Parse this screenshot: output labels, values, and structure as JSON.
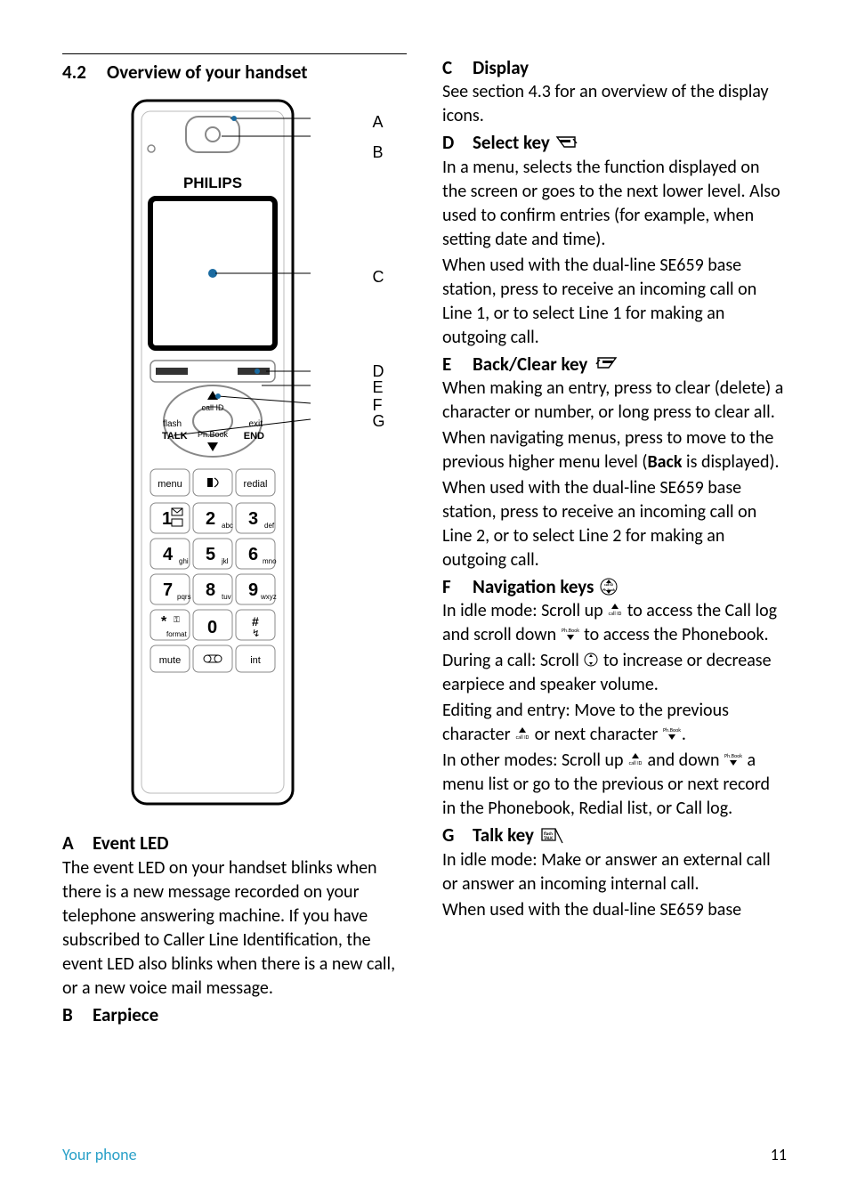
{
  "section": {
    "number": "4.2",
    "title": "Overview of your handset"
  },
  "callouts": [
    "A",
    "B",
    "C",
    "D",
    "E",
    "F",
    "G"
  ],
  "handset": {
    "brand": "PHILIPS",
    "keys": {
      "flash": "flash",
      "talk": "TALK",
      "exit": "exit",
      "end": "END",
      "call_id": "call ID",
      "phbook": "Ph.Book",
      "menu": "menu",
      "redial": "redial",
      "mute": "mute",
      "int": "int"
    },
    "digits": {
      "1_sub": "",
      "2": "2",
      "2_sub": "abc",
      "3": "3",
      "3_sub": "def",
      "4": "4",
      "4_sub": "ghi",
      "5": "5",
      "5_sub": "jkl",
      "6": "6",
      "6_sub": "mno",
      "7": "7",
      "7_sub": "pqrs",
      "8": "8",
      "8_sub": "tuv",
      "9": "9",
      "9_sub": "wxyz",
      "star": "*",
      "star_sub": "format",
      "0": "0",
      "hash": "#"
    }
  },
  "left": {
    "A": {
      "title": "Event LED",
      "text": "The event LED on your handset blinks when there is a new message recorded on your telephone answering machine. If you have subscribed to Caller Line Identification, the event LED also blinks when there is a new call, or a new voice mail message."
    },
    "B": {
      "title": "Earpiece"
    }
  },
  "right": {
    "C": {
      "title": "Display",
      "text": "See section 4.3 for an overview of the display icons."
    },
    "D": {
      "title": "Select key",
      "p1": "In a menu, selects the function displayed on the screen or goes to the next lower level. Also used to confirm entries (for example, when setting date and time).",
      "p2": "When used with the dual-line SE659 base station, press to receive an incoming call on Line 1, or to select Line 1 for making an outgoing call."
    },
    "E": {
      "title": "Back/Clear key",
      "p1": "When making an entry, press to clear (delete) a character or number, or long press to clear all.",
      "p2a": "When navigating menus, press to move to the previous higher menu level (",
      "p2_bold": "Back",
      "p2b": " is displayed).",
      "p3": "When used with the dual-line SE659 base station, press to receive an incoming call on Line 2, or to select Line 2 for making an outgoing call."
    },
    "F": {
      "title": "Navigation keys",
      "p1a": "In idle mode: Scroll up ",
      "p1b": " to access the Call log and scroll down ",
      "p1c": " to access the Phonebook.",
      "p2a": "During a call: Scroll ",
      "p2b": " to increase or decrease earpiece and speaker volume.",
      "p3a": "Editing and entry: Move to the previous character ",
      "p3b": " or next character ",
      "p3c": ".",
      "p4a": "In other modes: Scroll up ",
      "p4b": " and down ",
      "p4c": " a menu list or go to the previous or next record in the Phonebook, Redial list, or Call log."
    },
    "G": {
      "title": "Talk key",
      "p1": "In idle mode: Make or answer an external call or answer an incoming internal call.",
      "p2": "When used with the dual-line SE659 base"
    }
  },
  "footer": {
    "left": "Your phone",
    "page": "11"
  }
}
